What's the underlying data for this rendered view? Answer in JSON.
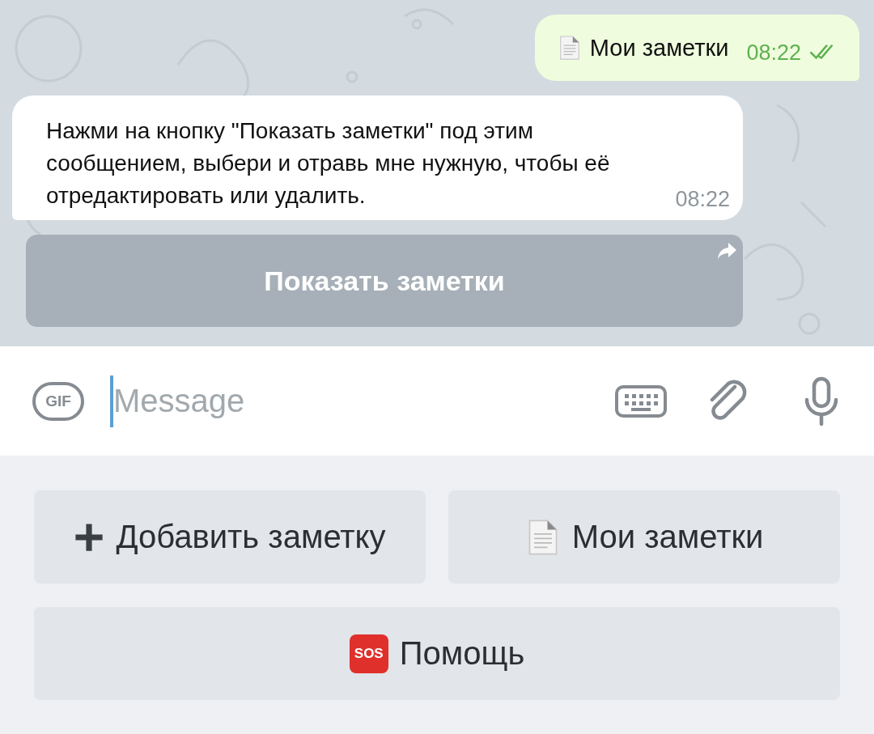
{
  "messages": [
    {
      "kind": "outgoing",
      "text": "Мои заметки",
      "time": "08:22",
      "read": true
    },
    {
      "kind": "incoming",
      "text": "Нажми на кнопку \"Показать заметки\" под этим сообщением, выбери и отравь мне нужную, чтобы её отредактировать или удалить.",
      "time": "08:22"
    }
  ],
  "inline_button": {
    "label": "Показать заметки"
  },
  "composer": {
    "gif_label": "GIF",
    "placeholder": "Message"
  },
  "reply_keyboard": [
    [
      {
        "kind": "plus",
        "label": "Добавить заметку"
      },
      {
        "kind": "document",
        "label": "Мои заметки"
      }
    ],
    [
      {
        "kind": "sos",
        "icon_text": "SOS",
        "label": "Помощь"
      }
    ]
  ]
}
